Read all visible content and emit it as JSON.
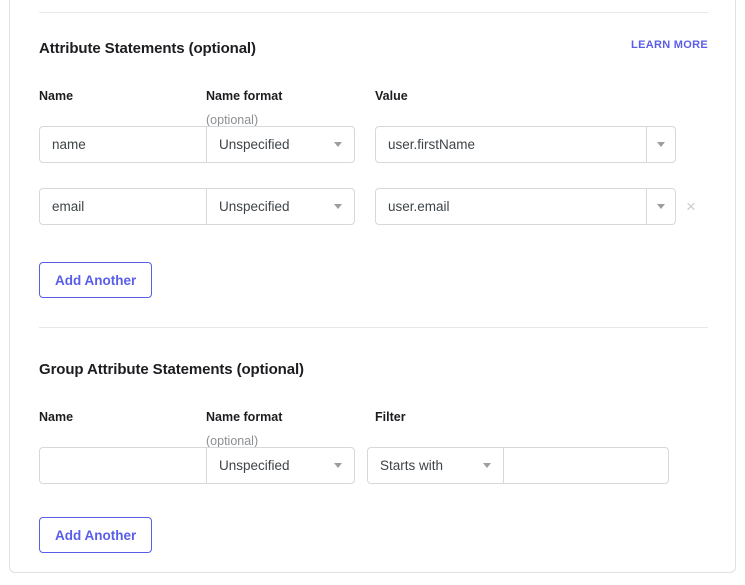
{
  "sections": [
    {
      "id": "attribute-statements",
      "title": "Attribute Statements (optional)",
      "learn_more_label": "LEARN MORE",
      "columns": {
        "name": "Name",
        "name_format": "Name format",
        "name_format_sub": "(optional)",
        "value": "Value"
      },
      "rows": [
        {
          "name_value": "name",
          "name_placeholder": "",
          "format_value": "Unspecified",
          "value_value": "user.firstName",
          "value_placeholder": "",
          "removable": false
        },
        {
          "name_value": "email",
          "name_placeholder": "",
          "format_value": "Unspecified",
          "value_value": "user.email",
          "value_placeholder": "",
          "removable": true,
          "remove_label": "×"
        }
      ],
      "add_label": "Add Another"
    },
    {
      "id": "group-attribute-statements",
      "title": "Group Attribute Statements (optional)",
      "columns": {
        "name": "Name",
        "name_format": "Name format",
        "name_format_sub": "(optional)",
        "filter": "Filter"
      },
      "rows": [
        {
          "name_value": "",
          "name_placeholder": "",
          "format_value": "Unspecified",
          "filter_value": "Starts with",
          "filter_text_value": "",
          "filter_text_placeholder": ""
        }
      ],
      "add_label": "Add Another"
    }
  ],
  "icons": {
    "caret_down": "caret-down-icon",
    "remove": "close-icon"
  },
  "colors": {
    "accent": "#5a5de8",
    "text": "#1d1d21",
    "muted": "#8c8f92",
    "border": "#d6d8da",
    "divider": "#e7e8ea"
  }
}
